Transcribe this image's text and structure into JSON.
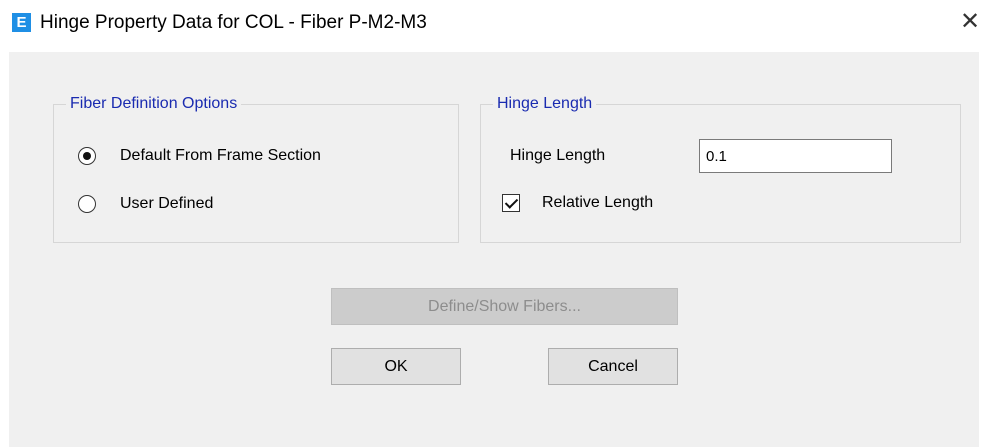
{
  "window": {
    "icon": "e-logo-icon",
    "title": "Hinge Property Data for COL - Fiber P-M2-M3",
    "close_glyph": "✕"
  },
  "fiber_options": {
    "title": "Fiber Definition Options",
    "options": [
      {
        "label": "Default From Frame Section",
        "selected": true
      },
      {
        "label": "User Defined",
        "selected": false
      }
    ]
  },
  "hinge_length": {
    "title": "Hinge Length",
    "field_label": "Hinge Length",
    "value": "0.1",
    "relative_label": "Relative Length",
    "relative_checked": true
  },
  "buttons": {
    "define_fibers": "Define/Show Fibers...",
    "ok": "OK",
    "cancel": "Cancel"
  },
  "colors": {
    "group_title": "#1a2bb0",
    "dialog_bg": "#f0f0f0",
    "app_icon": "#1f8fe5"
  }
}
